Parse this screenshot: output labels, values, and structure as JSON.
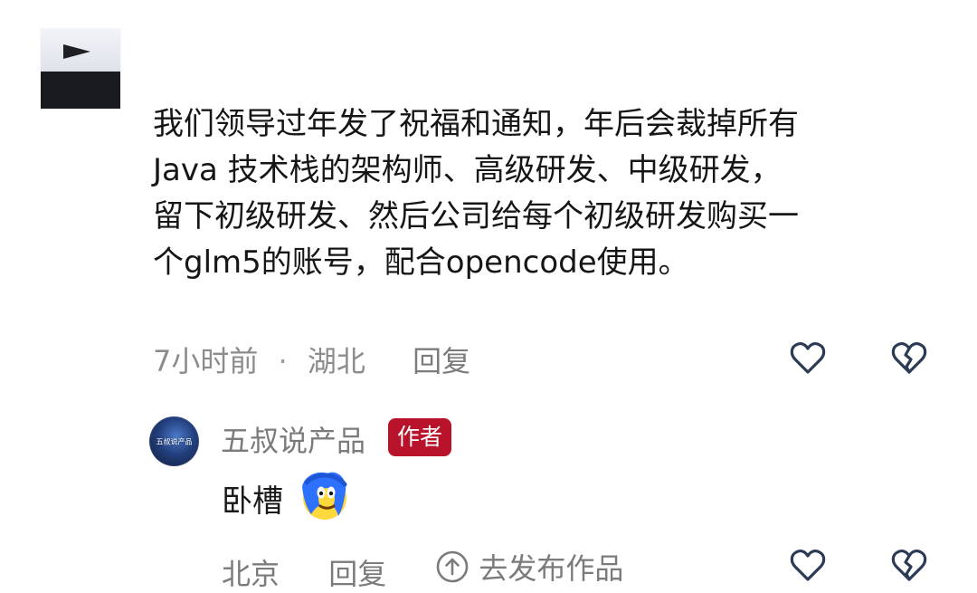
{
  "post": {
    "text_lines": [
      "我们领导过年发了祝福和通知，年后会裁掉所有",
      "Java 技术栈的架构师、高级研发、中级研发，",
      "留下初级研发、然后公司给每个初级研发购买一",
      "个glm5的账号，配合opencode使用。"
    ],
    "time": "7小时前",
    "separator": "·",
    "location": "湖北",
    "reply_label": "回复"
  },
  "reply": {
    "author": "五叔说产品",
    "badge": "作者",
    "avatar_text": "五叔说产品",
    "text": "卧槽",
    "location": "北京",
    "reply_label": "回复",
    "publish_label": "去发布作品"
  },
  "icons": {
    "like": "heart-outline-icon",
    "dislike": "broken-heart-icon",
    "publish": "up-arrow-circle-icon",
    "emoji": "blue-hair-emoji-icon"
  },
  "colors": {
    "badge_bg": "#b9132c",
    "meta_text": "#8c8c8c",
    "main_text": "#161616",
    "icon_stroke": "#2b3a55"
  }
}
